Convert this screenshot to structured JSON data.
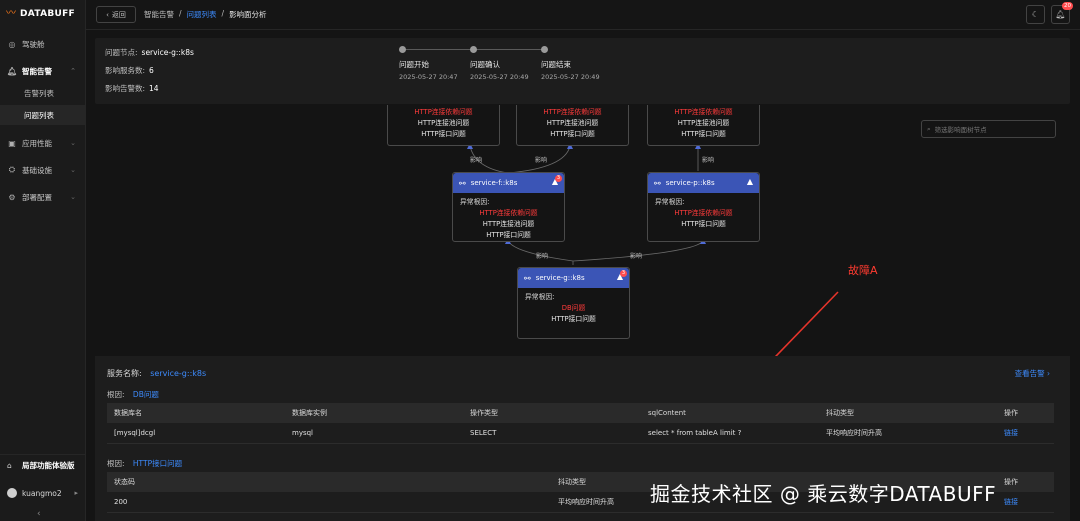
{
  "brand": {
    "name": "DATABUFF"
  },
  "sidebar": {
    "items": [
      {
        "label": "驾驶舱",
        "icon": "dashboard-icon"
      },
      {
        "label": "智能告警",
        "icon": "bell-icon"
      },
      {
        "label": "告警列表"
      },
      {
        "label": "问题列表"
      },
      {
        "label": "应用性能",
        "icon": "app-icon"
      },
      {
        "label": "基础设施",
        "icon": "infra-icon"
      },
      {
        "label": "部署配置",
        "icon": "deploy-icon"
      }
    ],
    "bottom": {
      "feature_label": "局部功能体验版",
      "user": "kuangmo2"
    }
  },
  "topbar": {
    "back_label": "返回",
    "crumbs": [
      "智能告警",
      "问题列表",
      "影响面分析"
    ],
    "separator": "/",
    "notification_count": "20"
  },
  "problem": {
    "node_label": "问题节点:",
    "node_value": "service-g::k8s",
    "affected_services_label": "影响服务数:",
    "affected_services_value": "6",
    "affected_alerts_label": "影响告警数:",
    "affected_alerts_value": "14",
    "timeline": [
      {
        "label": "问题开始",
        "time": "2025-05-27 20:47"
      },
      {
        "label": "问题确认",
        "time": "2025-05-27 20:49"
      },
      {
        "label": "问题结束",
        "time": "2025-05-27 20:49"
      }
    ]
  },
  "topology": {
    "search_placeholder": "筛选影响面树节点",
    "edge_label": "影响",
    "cause_label": "异常根因:",
    "top_nodes": [
      {
        "red": "HTTP连接依赖问题",
        "lines": [
          "HTTP连接池问题",
          "HTTP接口问题"
        ]
      },
      {
        "red": "HTTP连接依赖问题",
        "lines": [
          "HTTP连接池问题",
          "HTTP接口问题"
        ]
      },
      {
        "red": "HTTP连接依赖问题",
        "lines": [
          "HTTP连接池问题",
          "HTTP接口问题"
        ]
      }
    ],
    "nodes": [
      {
        "name": "service-f::k8s",
        "badge": "3",
        "red": "HTTP连接依赖问题",
        "lines": [
          "HTTP连接池问题",
          "HTTP接口问题"
        ]
      },
      {
        "name": "service-p::k8s",
        "badge": "",
        "red": "HTTP连接依赖问题",
        "lines": [
          "HTTP接口问题"
        ]
      },
      {
        "name": "service-g::k8s",
        "badge": "3",
        "red": "DB问题",
        "lines": [
          "HTTP接口问题"
        ]
      }
    ],
    "annotation": "故障A"
  },
  "detail": {
    "service_label": "服务名称:",
    "service_value": "service-g::k8s",
    "view_alerts": "查看告警 ›",
    "root_label": "根因:",
    "db_root": "DB问题",
    "db_table": {
      "headers": [
        "数据库名",
        "数据库实例",
        "操作类型",
        "sqlContent",
        "抖动类型",
        "操作"
      ],
      "rows": [
        [
          "[mysql]dcgl",
          "mysql",
          "SELECT",
          "select * from tableA limit ?",
          "平均响应时间升高",
          "链接"
        ]
      ]
    },
    "http_root": "HTTP接口问题",
    "http_table": {
      "headers": [
        "状态码",
        "抖动类型",
        "操作"
      ],
      "rows": [
        [
          "200",
          "平均响应时间升高",
          "链接"
        ]
      ]
    }
  },
  "watermark": "掘金技术社区 @ 乘云数字DATABUFF"
}
